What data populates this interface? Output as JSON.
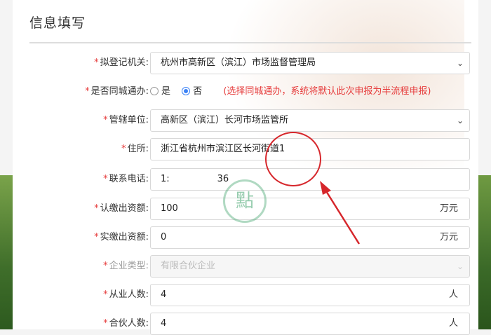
{
  "header": {
    "title": "信息填写"
  },
  "form": {
    "registration_authority": {
      "label": "拟登记机关:",
      "value": "杭州市高新区（滨江）市场监督管理局"
    },
    "same_city": {
      "label": "是否同城通办:",
      "option_yes": "是",
      "option_no": "否",
      "selected": "否",
      "note": "(选择同城通办，系统将默认此次申报为半流程申报)"
    },
    "jurisdiction": {
      "label": "管辖单位:",
      "value": "高新区（滨江）长河市场监管所"
    },
    "address": {
      "label": "住所:",
      "value": "浙江省杭州市滨江区长河街道1"
    },
    "phone": {
      "label": "联系电话:",
      "value_prefix": "1:",
      "value_suffix": "36"
    },
    "subscribed_capital": {
      "label": "认缴出资额:",
      "value": "100",
      "unit": "万元"
    },
    "paid_capital": {
      "label": "实缴出资额:",
      "value": "0",
      "unit": "万元"
    },
    "enterprise_type": {
      "label": "企业类型:",
      "value": "有限合伙企业"
    },
    "employees": {
      "label": "从业人数:",
      "value": "4",
      "unit": "人"
    },
    "partners": {
      "label": "合伙人数:",
      "value": "4",
      "unit": "人"
    }
  },
  "watermark": {
    "text": "點"
  },
  "colors": {
    "required": "#e63b3b",
    "radio_active": "#3b82f6",
    "annotation": "#d6262b"
  },
  "icons": {
    "select": "chevron-down-icon",
    "radio": "radio-icon"
  }
}
